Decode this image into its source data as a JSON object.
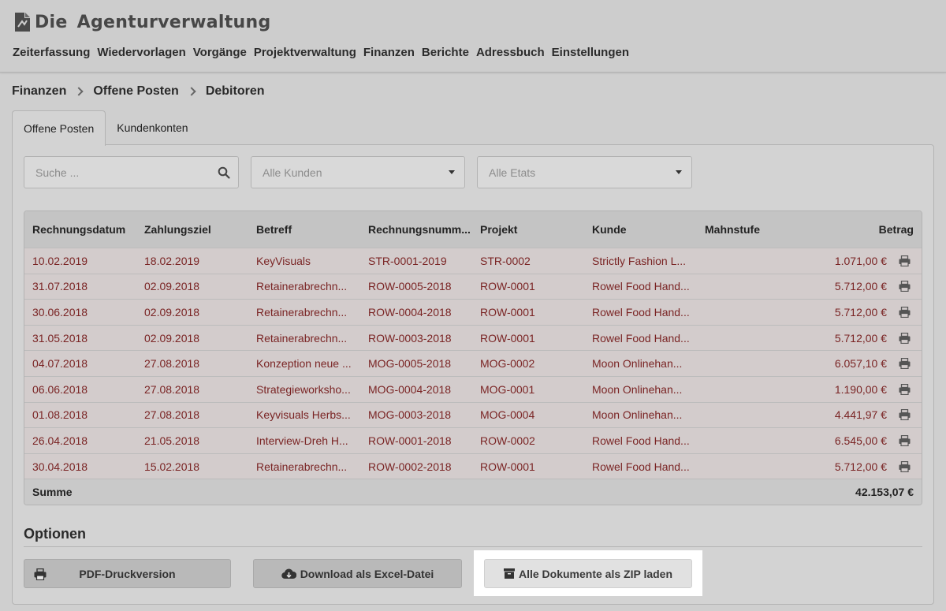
{
  "app": {
    "title_part1": "Die",
    "title_part2": "Agenturverwaltung",
    "nav": [
      "Zeiterfassung",
      "Wiedervorlagen",
      "Vorgänge",
      "Projektverwaltung",
      "Finanzen",
      "Berichte",
      "Adressbuch",
      "Einstellungen"
    ]
  },
  "breadcrumb": [
    "Finanzen",
    "Offene Posten",
    "Debitoren"
  ],
  "tabs": [
    {
      "label": "Offene Posten",
      "active": true
    },
    {
      "label": "Kundenkonten",
      "active": false
    }
  ],
  "filters": {
    "search_placeholder": "Suche ...",
    "customer_select": "Alle Kunden",
    "budget_select": "Alle Etats"
  },
  "table": {
    "columns": [
      "Rechnungsdatum",
      "Zahlungsziel",
      "Betreff",
      "Rechnungsnumm...",
      "Projekt",
      "Kunde",
      "Mahnstufe",
      "Betrag"
    ],
    "rows": [
      [
        "10.02.2019",
        "18.02.2019",
        "KeyVisuals",
        "STR-0001-2019",
        "STR-0002",
        "Strictly Fashion L...",
        "",
        "1.071,00 €"
      ],
      [
        "31.07.2018",
        "02.09.2018",
        "Retainerabrechn...",
        "ROW-0005-2018",
        "ROW-0001",
        "Rowel Food Hand...",
        "",
        "5.712,00 €"
      ],
      [
        "30.06.2018",
        "02.09.2018",
        "Retainerabrechn...",
        "ROW-0004-2018",
        "ROW-0001",
        "Rowel Food Hand...",
        "",
        "5.712,00 €"
      ],
      [
        "31.05.2018",
        "02.09.2018",
        "Retainerabrechn...",
        "ROW-0003-2018",
        "ROW-0001",
        "Rowel Food Hand...",
        "",
        "5.712,00 €"
      ],
      [
        "04.07.2018",
        "27.08.2018",
        "Konzeption neue ...",
        "MOG-0005-2018",
        "MOG-0002",
        "Moon Onlinehan...",
        "",
        "6.057,10 €"
      ],
      [
        "06.06.2018",
        "27.08.2018",
        "Strategieworksho...",
        "MOG-0004-2018",
        "MOG-0001",
        "Moon Onlinehan...",
        "",
        "1.190,00 €"
      ],
      [
        "01.08.2018",
        "27.08.2018",
        "Keyvisuals Herbs...",
        "MOG-0003-2018",
        "MOG-0004",
        "Moon Onlinehan...",
        "",
        "4.441,97 €"
      ],
      [
        "26.04.2018",
        "21.05.2018",
        "Interview-Dreh H...",
        "ROW-0001-2018",
        "ROW-0002",
        "Rowel Food Hand...",
        "",
        "6.545,00 €"
      ],
      [
        "30.04.2018",
        "15.02.2018",
        "Retainerabrechn...",
        "ROW-0002-2018",
        "ROW-0001",
        "Rowel Food Hand...",
        "",
        "5.712,00 €"
      ]
    ],
    "sum_label": "Summe",
    "sum_value": "42.153,07 €"
  },
  "options": {
    "title": "Optionen",
    "pdf_button": "PDF-Druckversion",
    "excel_button": "Download als Excel-Datei",
    "zip_button": "Alle Dokumente als ZIP laden"
  },
  "colors": {
    "overdue_text": "#7a2424",
    "highlight": "#ffffff"
  }
}
